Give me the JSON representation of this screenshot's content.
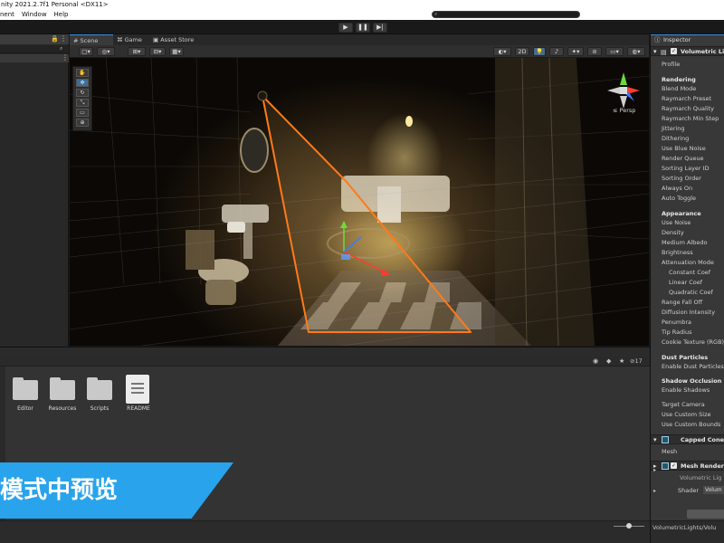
{
  "window": {
    "title": "nity 2021.2.7f1 Personal <DX11>"
  },
  "menu": [
    "nent",
    "Window",
    "Help"
  ],
  "toolbar": {
    "play": "▶",
    "pause": "❚❚",
    "step": "▶|"
  },
  "scene": {
    "tabs": [
      {
        "label": "Scene",
        "icon": "hash-icon"
      },
      {
        "label": "Game",
        "icon": "gamepad-icon"
      },
      {
        "label": "Asset Store",
        "icon": "bag-icon"
      }
    ],
    "toolbar_2d": "2D",
    "persp_label": "Persp",
    "gizmo_axes": {
      "y": "y",
      "z": "z",
      "x": "x"
    }
  },
  "project": {
    "count_label": "17",
    "items": [
      {
        "label": "Editor",
        "kind": "folder"
      },
      {
        "label": "Resources",
        "kind": "folder"
      },
      {
        "label": "Scripts",
        "kind": "folder"
      },
      {
        "label": "README",
        "kind": "doc"
      }
    ],
    "banner_text": "模式中预览"
  },
  "inspector": {
    "tab_label": "Inspector",
    "object_name": "Volumetric Ligh",
    "profile_label": "Profile",
    "rendering": {
      "header": "Rendering",
      "items": [
        "Blend Mode",
        "Raymarch Preset",
        "Raymarch Quality",
        "Raymarch Min Step",
        "Jittering",
        "Dithering",
        "Use Blue Noise",
        "Render Queue",
        "Sorting Layer ID",
        "Sorting Order",
        "Always On",
        "Auto Toggle"
      ]
    },
    "appearance": {
      "header": "Appearance",
      "items": [
        "Use Noise",
        "Density",
        "Medium Albedo",
        "Brightness",
        "Attenuation Mode"
      ],
      "attenuation_sub": [
        "Constant Coef",
        "Linear Coef",
        "Quadratic Coef"
      ],
      "items_after": [
        "Range Fall Off",
        "Diffusion Intensity",
        "Penumbra",
        "Tip Radius",
        "Cookie Texture (RGB)"
      ]
    },
    "dust": {
      "header": "Dust Particles",
      "items": [
        "Enable Dust Particles"
      ]
    },
    "shadow": {
      "header": "Shadow Occlusion",
      "items": [
        "Enable Shadows"
      ]
    },
    "misc": [
      "Target Camera",
      "Use Custom Size",
      "Use Custom Bounds"
    ],
    "capped_cone": "Capped Cone (",
    "mesh_label": "Mesh",
    "mesh_renderer": "Mesh Rendere",
    "material_name": "Volumetric Lig",
    "shader_label": "Shader",
    "shader_value": "Volum",
    "footer": "VolumetricLights/Volu"
  },
  "colors": {
    "accent": "#29a3ec",
    "cone": "#ff7a1a",
    "selected": "#3f8fd8"
  }
}
